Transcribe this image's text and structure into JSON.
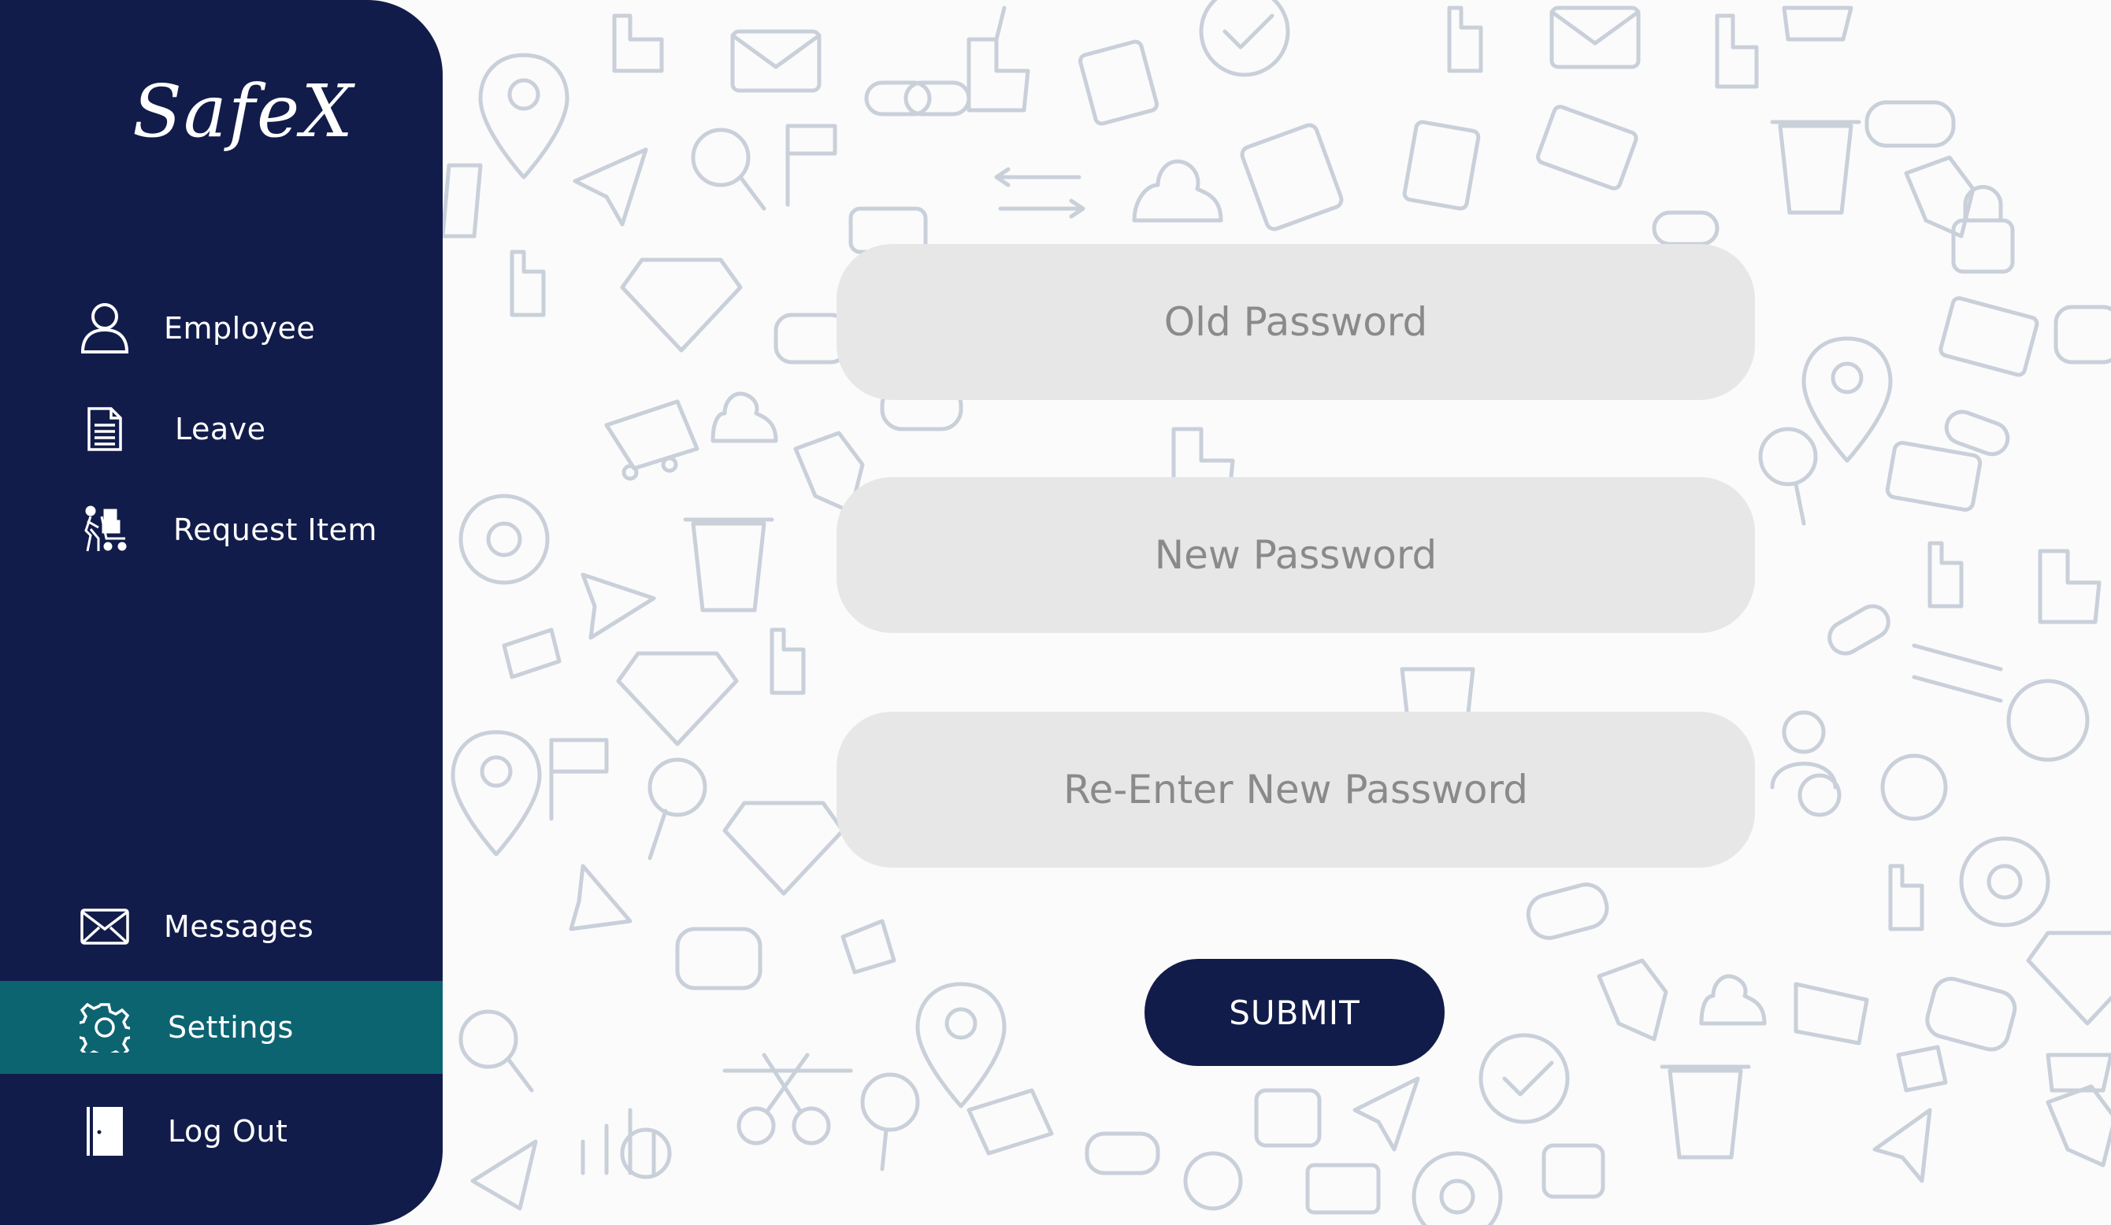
{
  "app": {
    "logo": "SafeX"
  },
  "sidebar": {
    "items": [
      {
        "label": "Employee",
        "icon": "user-icon"
      },
      {
        "label": "Leave",
        "icon": "document-icon"
      },
      {
        "label": "Request Item",
        "icon": "porter-cart-icon"
      }
    ],
    "bottom_items": [
      {
        "label": "Messages",
        "icon": "envelope-icon"
      },
      {
        "label": "Settings",
        "icon": "gear-icon",
        "active": true
      },
      {
        "label": "Log Out",
        "icon": "door-icon"
      }
    ]
  },
  "form": {
    "old_password": {
      "placeholder": "Old Password",
      "value": ""
    },
    "new_password": {
      "placeholder": "New Password",
      "value": ""
    },
    "confirm_password": {
      "placeholder": "Re-Enter New Password",
      "value": ""
    },
    "submit_label": "SUBMIT"
  },
  "colors": {
    "sidebar": "#121c4a",
    "active_item": "#0d6471",
    "field_bg": "#e7e7e7",
    "button": "#121c4a",
    "doodle": "#c5ccd6"
  }
}
